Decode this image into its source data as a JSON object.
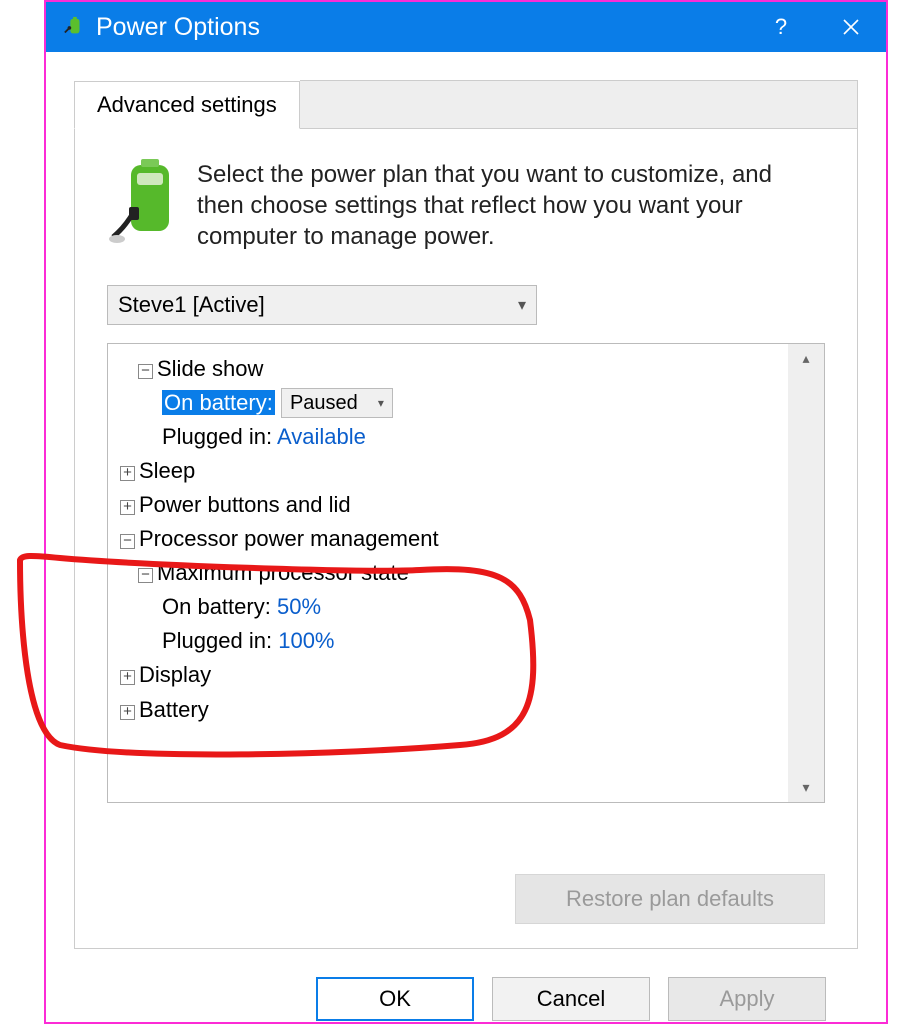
{
  "titlebar": {
    "title": "Power Options"
  },
  "tab": {
    "label": "Advanced settings"
  },
  "intro": "Select the power plan that you want to customize, and then choose settings that reflect how you want your computer to manage power.",
  "plan_select": {
    "value": "Steve1 [Active]"
  },
  "tree": {
    "slideshow": {
      "label": "Slide show",
      "on_battery_label": "On battery:",
      "on_battery_value": "Paused",
      "plugged_label": "Plugged in:",
      "plugged_value": "Available"
    },
    "sleep": {
      "label": "Sleep"
    },
    "power_buttons": {
      "label": "Power buttons and lid"
    },
    "ppm": {
      "label": "Processor power management",
      "max_state": {
        "label": "Maximum processor state",
        "on_battery_label": "On battery:",
        "on_battery_value": "50%",
        "plugged_label": "Plugged in:",
        "plugged_value": "100%"
      }
    },
    "display": {
      "label": "Display"
    },
    "battery": {
      "label": "Battery"
    }
  },
  "restore_label": "Restore plan defaults",
  "buttons": {
    "ok": "OK",
    "cancel": "Cancel",
    "apply": "Apply"
  }
}
